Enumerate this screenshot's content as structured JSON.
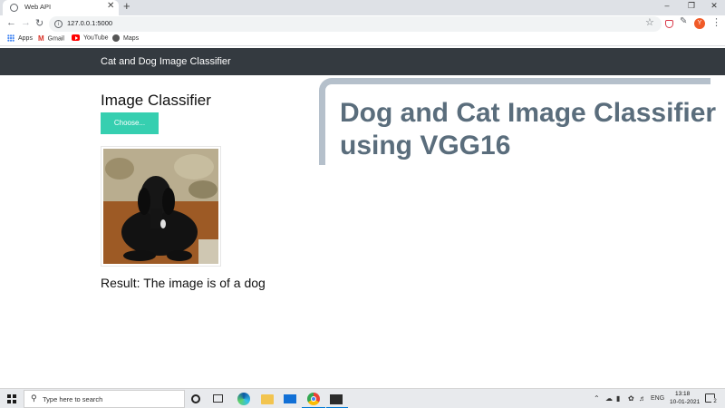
{
  "browser": {
    "tab_title": "Web API",
    "url": "127.0.0.1:5000",
    "new_tab_symbol": "+",
    "close_symbol": "✕",
    "avatar_letter": "Y",
    "bookmarks": [
      {
        "label": "Apps",
        "icon": "apps-grid-icon"
      },
      {
        "label": "Gmail",
        "icon": "gmail-icon"
      },
      {
        "label": "YouTube",
        "icon": "youtube-icon"
      },
      {
        "label": "Maps",
        "icon": "maps-icon"
      }
    ]
  },
  "navbar": {
    "brand": "Cat and Dog Image Classifier",
    "background": "#343a40"
  },
  "classifier": {
    "heading": "Image Classifier",
    "choose_label": "Choose...",
    "button_color": "#36cfb0",
    "result_text": "Result: The image is of a dog",
    "preview_alt": "black dog photo"
  },
  "hero": {
    "title": "Dog and Cat Image Classifier using VGG16",
    "title_color": "#5a6d7c",
    "border_color": "#b5c0cb"
  },
  "taskbar": {
    "search_placeholder": "Type here to search",
    "language": "ENG",
    "time": "13:18",
    "date": "10-01-2021",
    "notification_count": "2"
  }
}
